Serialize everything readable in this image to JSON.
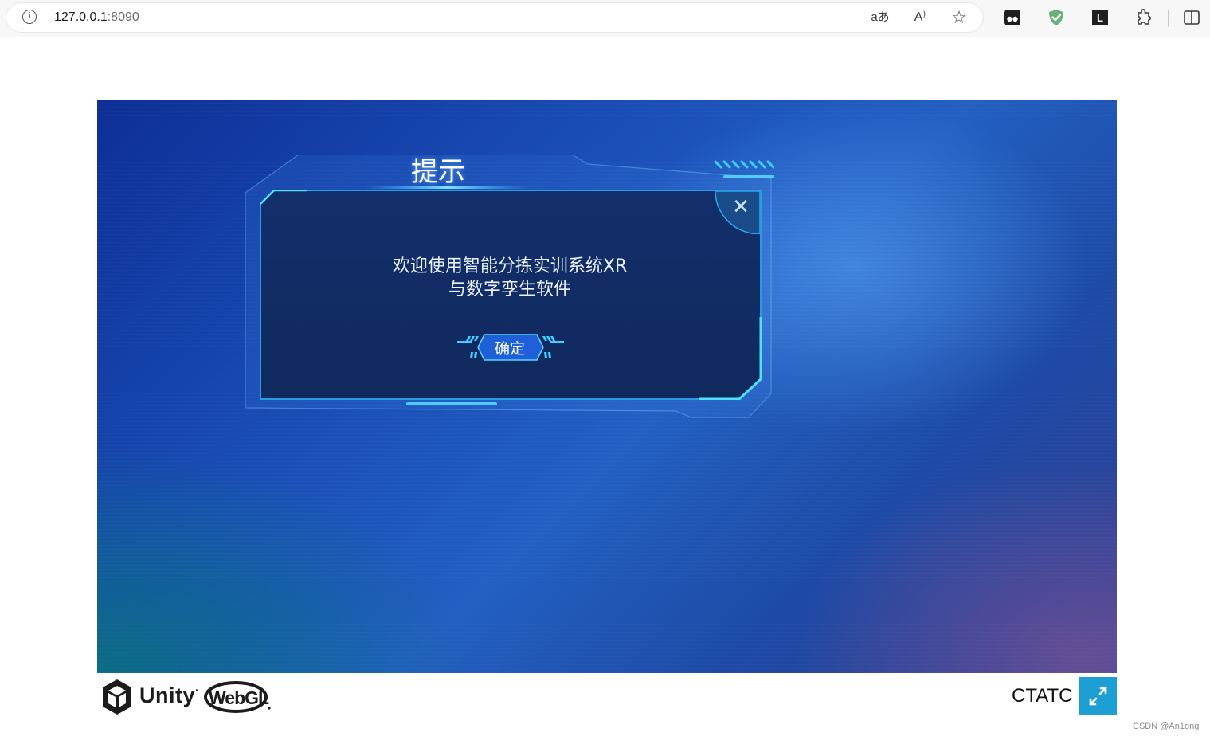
{
  "browser": {
    "url_host": "127.0.0.1",
    "url_port": ":8090",
    "address_icons": [
      "info-icon",
      "translate-icon",
      "read-aloud-icon",
      "favorite-star-icon"
    ],
    "extension_icons": [
      "tampermonkey-icon",
      "adguard-shield-icon",
      "extension-l-icon",
      "extensions-puzzle-icon",
      "split-screen-icon"
    ],
    "translate_glyph": "aあ",
    "read_aloud_glyph": "A⁾",
    "star_glyph": "☆",
    "ext_l_letter": "L"
  },
  "dialog": {
    "title": "提示",
    "message_line1": "欢迎使用智能分拣实训系统XR",
    "message_line2": "与数字孪生软件",
    "confirm_label": "确定",
    "close_glyph": "✕"
  },
  "footer": {
    "unity_text": "Unity",
    "unity_tm": "·",
    "webgl_text": "WebGL",
    "title": "CTATC"
  },
  "watermark": "CSDN @An1ong",
  "colors": {
    "accent": "#1e9fd3",
    "dialog_glow": "#29c8ff",
    "dialog_fill": "#132e6b"
  }
}
